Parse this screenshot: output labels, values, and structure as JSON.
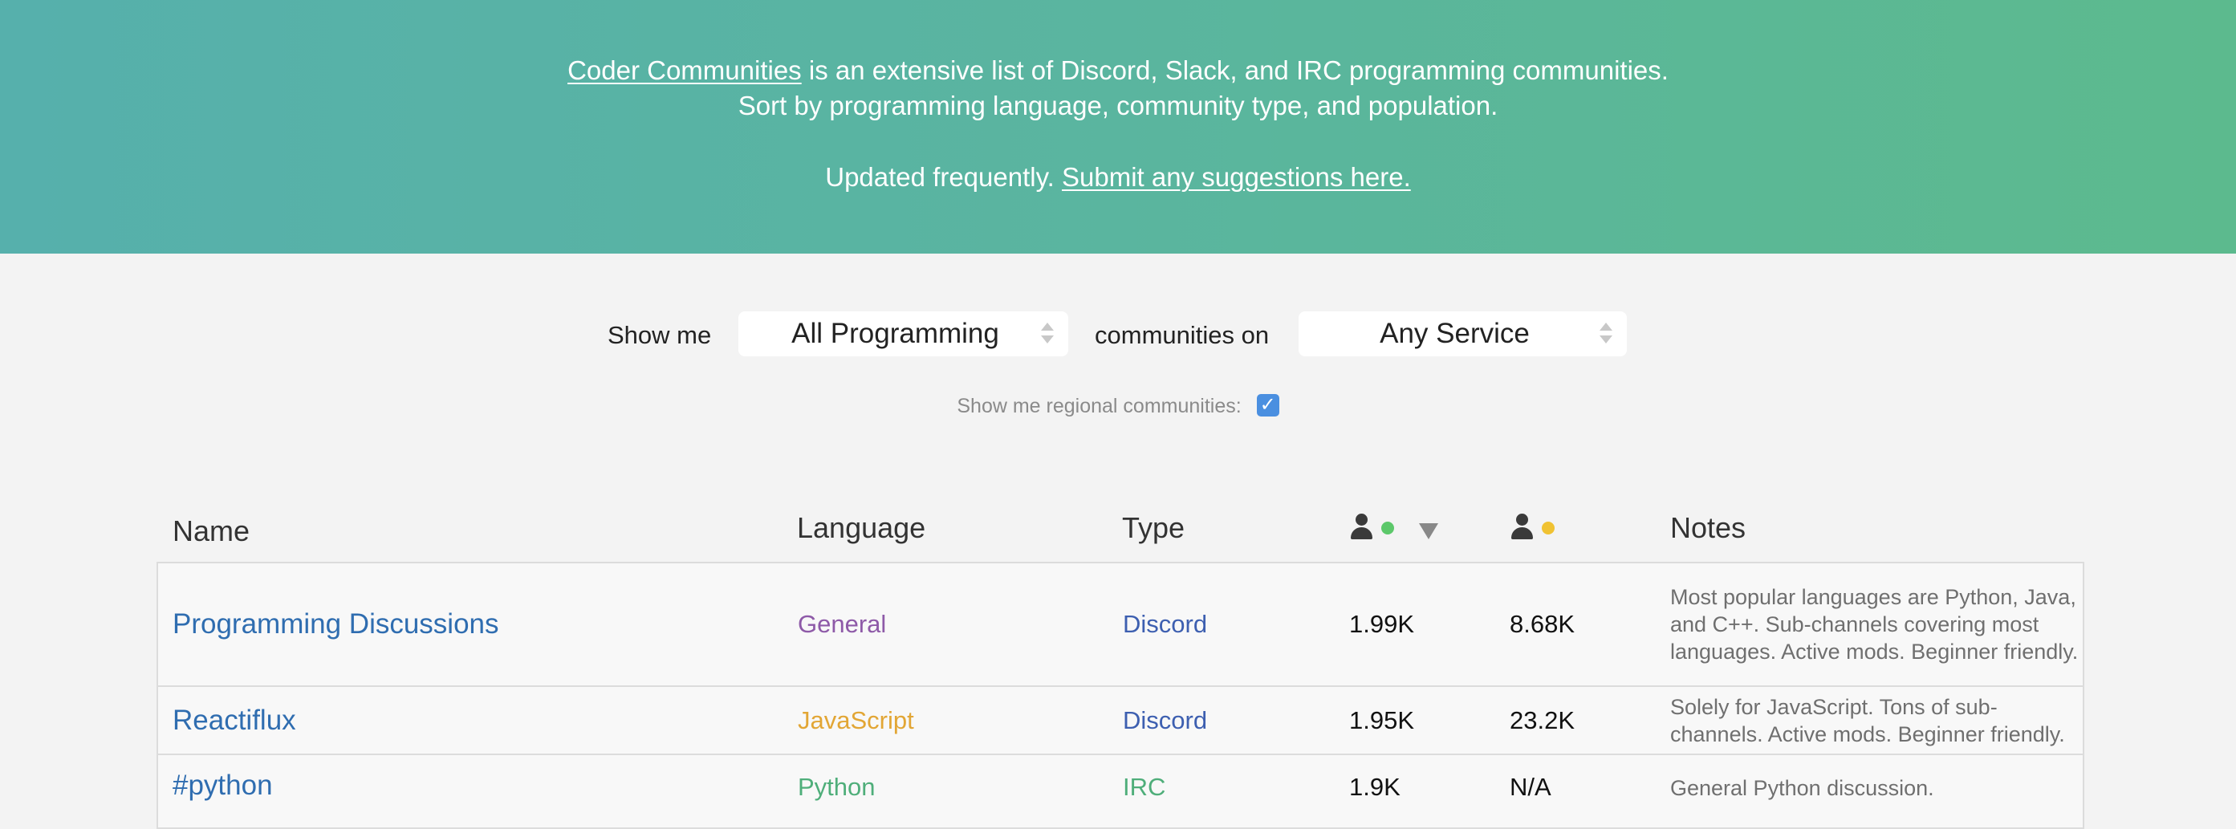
{
  "hero": {
    "line1_link": "Coder Communities",
    "line1_rest": " is an extensive list of Discord, Slack, and IRC programming communities.",
    "line2": "Sort by programming language, community type, and population.",
    "line3_text": "Updated frequently. ",
    "line3_link": "Submit any suggestions here."
  },
  "filters": {
    "show_me_label": "Show me",
    "language_select": "All Programming",
    "communities_on_label": "communities on",
    "service_select": "Any Service",
    "regional_label": "Show me regional communities:",
    "regional_checked": true,
    "check_glyph": "✓"
  },
  "table": {
    "headers": {
      "name": "Name",
      "language": "Language",
      "type": "Type",
      "online_icon": "person-online-icon",
      "total_icon": "person-total-icon",
      "notes": "Notes"
    },
    "colors": {
      "online_dot": "#5cc86a",
      "total_dot": "#f0c232"
    },
    "rows": [
      {
        "name": "Programming Discussions",
        "language": "General",
        "language_color": "#8e5aa8",
        "type": "Discord",
        "type_color": "#3d5fb0",
        "online": "1.99K",
        "total": "8.68K",
        "notes": "Most popular languages are Python, Java, and C++. Sub-channels covering most languages. Active mods. Beginner friendly."
      },
      {
        "name": "Reactiflux",
        "language": "JavaScript",
        "language_color": "#e2a635",
        "type": "Discord",
        "type_color": "#3d5fb0",
        "online": "1.95K",
        "total": "23.2K",
        "notes": "Solely for JavaScript. Tons of sub-channels. Active mods. Beginner friendly."
      },
      {
        "name": "#python",
        "language": "Python",
        "language_color": "#4fae7a",
        "type": "IRC",
        "type_color": "#4fae7a",
        "online": "1.9K",
        "total": "N/A",
        "notes": "General Python discussion."
      }
    ]
  }
}
